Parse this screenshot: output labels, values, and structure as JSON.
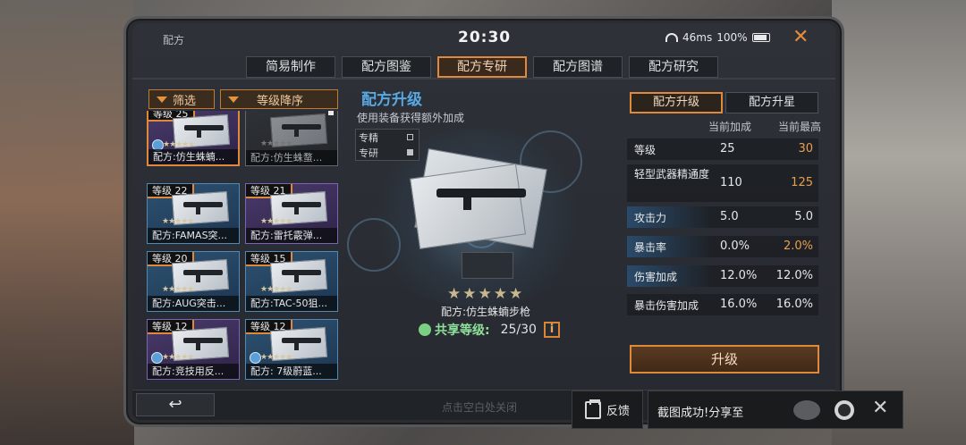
{
  "status": {
    "app_title": "配方",
    "time": "20:30",
    "network": "46ms",
    "battery": "100%"
  },
  "tabs": [
    {
      "label": "简易制作"
    },
    {
      "label": "配方图鉴"
    },
    {
      "label": "配方专研",
      "active": true
    },
    {
      "label": "配方图谱"
    },
    {
      "label": "配方研究"
    }
  ],
  "filters": {
    "filter_label": "筛选",
    "sort_label": "等级降序"
  },
  "cards": [
    {
      "level": "等级 25",
      "name": "配方:仿生蛛蝻...",
      "selected": true
    },
    {
      "level": "",
      "name": "配方:仿生蛛蝥..."
    },
    {
      "level": "等级 22",
      "name": "配方:FAMAS突..."
    },
    {
      "level": "等级 21",
      "name": "配方:雷托霰弹..."
    },
    {
      "level": "等级 20",
      "name": "配方:AUG突击..."
    },
    {
      "level": "等级 15",
      "name": "配方:TAC-50狙..."
    },
    {
      "level": "等级 12",
      "name": "配方:竞技用反..."
    },
    {
      "level": "等级 12",
      "name": "配方: 7级蔚蓝..."
    }
  ],
  "center": {
    "title": "配方升级",
    "subtitle": "使用装备获得额外加成",
    "legend": [
      "专精",
      "专研"
    ],
    "weapon_name": "配方:仿生蛛蝻步枪",
    "share_label": "共享等级:",
    "share_value": "25/30",
    "info_icon": "i"
  },
  "right": {
    "tabs": [
      "配方升级",
      "配方升星"
    ],
    "col_current": "当前加成",
    "col_max": "当前最高",
    "stats": [
      {
        "name": "等级",
        "current": "25",
        "max": "30"
      },
      {
        "name": "轻型武器精通度",
        "current": "110",
        "max": "125"
      },
      {
        "name": "攻击力",
        "current": "5.0",
        "max": "5.0"
      },
      {
        "name": "暴击率",
        "current": "0.0%",
        "max": "2.0%"
      },
      {
        "name": "伤害加成",
        "current": "12.0%",
        "max": "12.0%"
      },
      {
        "name": "暴击伤害加成",
        "current": "16.0%",
        "max": "16.0%"
      }
    ],
    "upgrade_label": "升级"
  },
  "bottom": {
    "back_icon": "↩",
    "hint": "点击空白处关闭"
  },
  "overlay": {
    "feedback_label": "反馈",
    "toast_text": "截图成功!分享至"
  },
  "colors": {
    "accent": "#e0893b",
    "title_blue": "#58a8e3",
    "highlight": "#e6a04f"
  }
}
